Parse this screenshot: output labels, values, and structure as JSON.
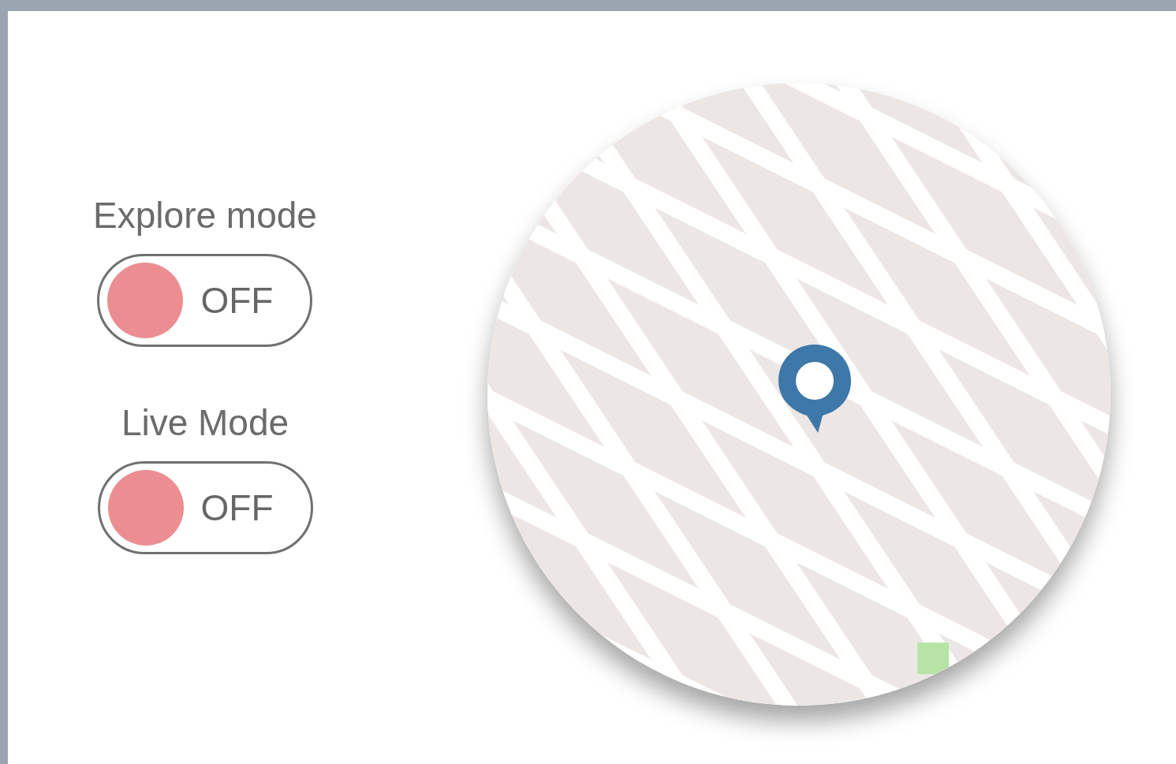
{
  "settings": [
    {
      "label": "Explore mode",
      "toggle": {
        "on": false,
        "text": "OFF"
      }
    },
    {
      "label": "Live Mode",
      "toggle": {
        "on": false,
        "text": "OFF"
      }
    }
  ]
}
